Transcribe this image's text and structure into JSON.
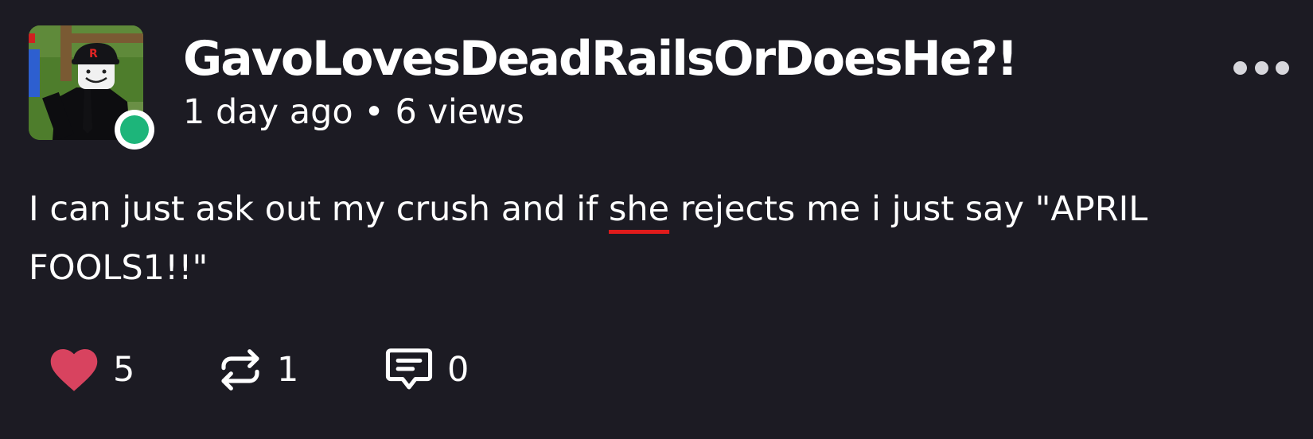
{
  "post": {
    "author": {
      "username": "GavoLovesDeadRailsOrDoesHe?!",
      "online": true,
      "avatar_icon": "roblox-avatar-icon",
      "presence_color": "#1db57a"
    },
    "meta": "1 day ago • 6 views",
    "body": {
      "part1": "I can just ask out my crush and if ",
      "misspelled": "she",
      "part2": " rejects me i just say \"APRIL",
      "line2": "FOOLS1!!\""
    },
    "actions": {
      "like": {
        "icon": "heart-icon",
        "count": "5",
        "color": "#d8435f"
      },
      "repost": {
        "icon": "repost-icon",
        "count": "1"
      },
      "comment": {
        "icon": "comment-icon",
        "count": "0"
      }
    },
    "more_icon": "more-dots-icon"
  },
  "theme": {
    "background": "#1c1b23",
    "text": "#ffffff",
    "spellcheck_underline": "#e01b1b"
  }
}
